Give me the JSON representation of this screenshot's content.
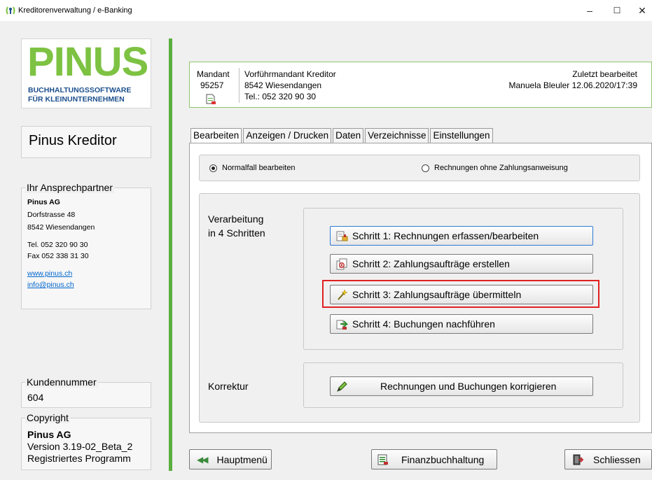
{
  "window": {
    "title": "Kreditorenverwaltung / e-Banking",
    "controls": {
      "minimize": "–",
      "maximize": "☐",
      "close": "✕"
    }
  },
  "logo": {
    "word": "PINUS",
    "line1": "BUCHHALTUNGSSOFTWARE",
    "line2": "FÜR KLEINUNTERNEHMEN"
  },
  "product_name": "Pinus Kreditor",
  "contact": {
    "legend": "Ihr Ansprechpartner",
    "company": "Pinus AG",
    "street": "Dorfstrasse 48",
    "city": "8542 Wiesendangen",
    "tel": "Tel. 052 320 90 30",
    "fax": "Fax  052 338 31 30",
    "web": "www.pinus.ch",
    "email": "info@pinus.ch"
  },
  "customer": {
    "legend": "Kundennummer",
    "value": "604"
  },
  "copyright": {
    "legend": "Copyright",
    "company": "Pinus AG",
    "version": "Version 3.19-02_Beta_2",
    "status": "Registriertes Programm"
  },
  "mandant": {
    "label": "Mandant",
    "number": "95257",
    "name": "Vorführmandant Kreditor",
    "city": "8542 Wiesendangen",
    "tel": "Tel.: 052 320 90 30",
    "last_edited_label": "Zuletzt bearbeitet",
    "last_edited_value": "Manuela Bleuler 12.06.2020/17:39"
  },
  "tabs": [
    "Bearbeiten",
    "Anzeigen / Drucken",
    "Daten",
    "Verzeichnisse",
    "Einstellungen"
  ],
  "active_tab": "Bearbeiten",
  "radios": {
    "normal": "Normalfall bearbeiten",
    "without": "Rechnungen ohne Zahlungsanweisung",
    "selected": "Normalfall bearbeiten"
  },
  "processing": {
    "label_line1": "Verarbeitung",
    "label_line2": "in 4 Schritten",
    "step1": "Schritt 1: Rechnungen erfassen/bearbeiten",
    "step2": "Schritt 2: Zahlungsaufträge erstellen",
    "step3": "Schritt 3: Zahlungsaufträge übermitteln",
    "step4": "Schritt 4: Buchungen nachführen"
  },
  "correction": {
    "label": "Korrektur",
    "button": "Rechnungen und Buchungen korrigieren"
  },
  "bottom": {
    "main_menu": "Hauptmenü",
    "finance": "Finanzbuchhaltung",
    "close": "Schliessen"
  },
  "colors": {
    "brand_green": "#7dc242",
    "brand_blue": "#1b4f8c",
    "divider_green": "#5aaf3f",
    "highlight_red": "#e02020"
  }
}
